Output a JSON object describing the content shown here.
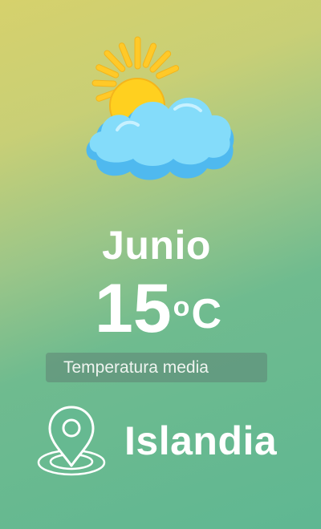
{
  "weather": {
    "icon": "sun-behind-cloud-icon",
    "month": "Junio",
    "temperature_value": "15",
    "temperature_degree": "o",
    "temperature_unit": "C",
    "caption": "Temperatura media"
  },
  "location": {
    "icon": "map-pin-icon",
    "name": "Islandia"
  },
  "colors": {
    "background_top": "#d6d16c",
    "background_bottom": "#5fb792",
    "sun": "#ffc928",
    "cloud": "#7fd6f7",
    "text": "#ffffff"
  }
}
